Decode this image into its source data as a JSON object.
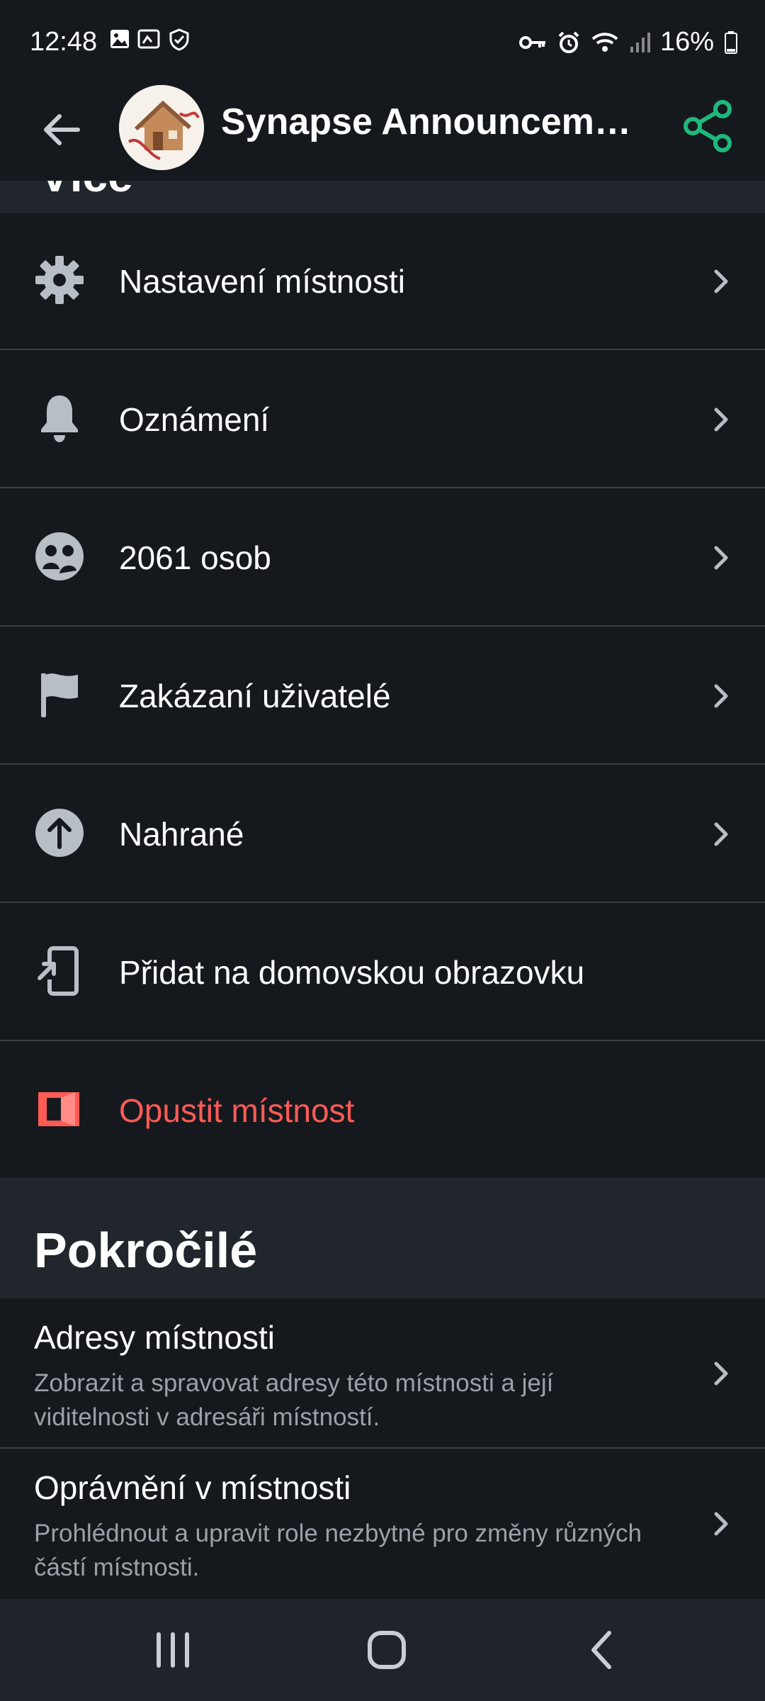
{
  "status_bar": {
    "time": "12:48",
    "battery": "16%",
    "icons_left": [
      "gallery-icon",
      "image-icon",
      "shield-icon"
    ],
    "icons_right": [
      "key-icon",
      "alarm-icon",
      "wifi-icon",
      "signal-icon",
      "battery-icon"
    ]
  },
  "app_bar": {
    "title": "Synapse Announceme…",
    "accent_color": "#1fb87d"
  },
  "partial_heading": "Více",
  "menu": [
    {
      "label": "Nastavení místnosti",
      "icon": "gear-icon"
    },
    {
      "label": "Oznámení",
      "icon": "bell-icon"
    },
    {
      "label": "2061 osob",
      "icon": "people-icon"
    },
    {
      "label": "Zakázaní uživatelé",
      "icon": "flag-icon"
    },
    {
      "label": "Nahrané",
      "icon": "upload-icon"
    },
    {
      "label": "Přidat na domovskou obrazovku",
      "icon": "add-to-home-icon"
    },
    {
      "label": "Opustit místnost",
      "icon": "leave-icon",
      "color": "#ff5b55"
    }
  ],
  "advanced": {
    "title": "Pokročilé",
    "items": [
      {
        "title": "Adresy místnosti",
        "description": "Zobrazit a spravovat adresy této místnosti a její viditelnosti v adresáři místností."
      },
      {
        "title": "Oprávnění v místnosti",
        "description": "Prohlédnout a upravit role nezbytné pro změny různých částí místnosti."
      }
    ]
  },
  "nav_bar": {
    "buttons": [
      "recent-apps-icon",
      "home-icon",
      "back-icon"
    ]
  }
}
